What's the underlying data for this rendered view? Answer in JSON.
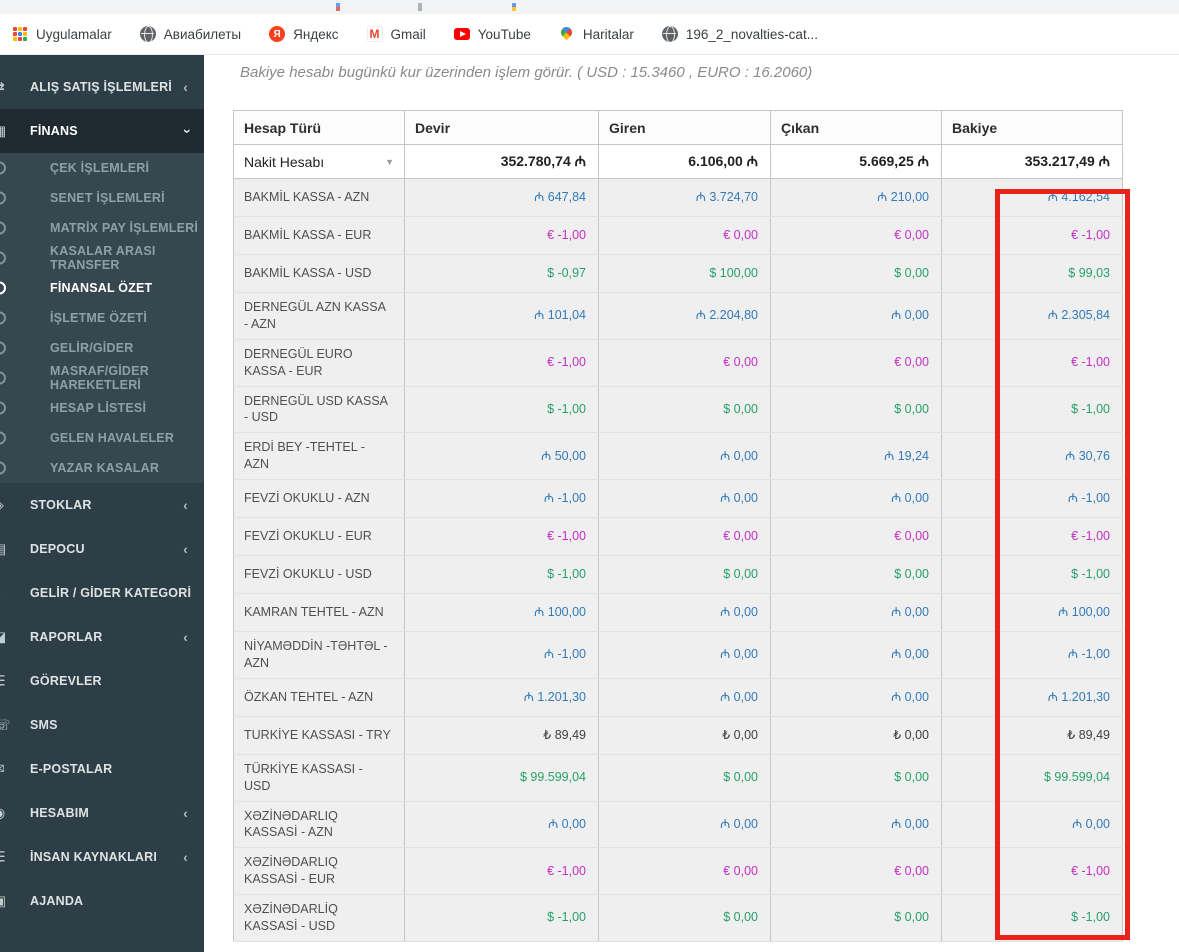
{
  "browser": {
    "bookmarks": [
      {
        "label": "Uygulamalar",
        "icon": "apps-grid-icon"
      },
      {
        "label": "Авиабилеты",
        "icon": "globe-icon"
      },
      {
        "label": "Яндекс",
        "icon": "yandex-icon"
      },
      {
        "label": "Gmail",
        "icon": "gmail-icon"
      },
      {
        "label": "YouTube",
        "icon": "youtube-icon"
      },
      {
        "label": "Haritalar",
        "icon": "maps-icon"
      },
      {
        "label": "196_2_novalties-cat...",
        "icon": "globe-icon"
      }
    ]
  },
  "sidebar": {
    "items": [
      {
        "label": "ALIŞ SATIŞ İŞLEMLERİ",
        "type": "main",
        "chevron": "left",
        "icon": "trade-icon"
      },
      {
        "label": "FİNANS",
        "type": "main",
        "chevron": "down",
        "icon": "finance-icon",
        "open": true
      },
      {
        "label": "ÇEK İŞLEMLERİ",
        "type": "sub",
        "icon": "circle-icon"
      },
      {
        "label": "SENET İŞLEMLERİ",
        "type": "sub",
        "icon": "circle-icon"
      },
      {
        "label": "MATRİX PAY İŞLEMLERİ",
        "type": "sub",
        "icon": "circle-icon"
      },
      {
        "label": "KASALAR ARASI TRANSFER",
        "type": "sub",
        "icon": "circle-icon"
      },
      {
        "label": "FİNANSAL ÖZET",
        "type": "sub",
        "icon": "circle-icon",
        "active": true
      },
      {
        "label": "İŞLETME ÖZETİ",
        "type": "sub",
        "icon": "circle-icon"
      },
      {
        "label": "GELİR/GİDER",
        "type": "sub",
        "icon": "circle-icon"
      },
      {
        "label": "MASRAF/GİDER HAREKETLERİ",
        "type": "sub",
        "icon": "circle-icon"
      },
      {
        "label": "HESAP LİSTESİ",
        "type": "sub",
        "icon": "circle-icon"
      },
      {
        "label": "GELEN HAVALELER",
        "type": "sub",
        "icon": "circle-icon"
      },
      {
        "label": "YAZAR KASALAR",
        "type": "sub",
        "icon": "circle-icon"
      },
      {
        "label": "STOKLAR",
        "type": "main",
        "chevron": "left",
        "icon": "stock-icon"
      },
      {
        "label": "DEPOCU",
        "type": "main",
        "chevron": "left",
        "icon": "warehouse-icon"
      },
      {
        "label": "GELİR / GİDER KATEGORİ",
        "type": "main",
        "icon": "category-icon"
      },
      {
        "label": "RAPORLAR",
        "type": "main",
        "chevron": "left",
        "icon": "reports-icon"
      },
      {
        "label": "GÖREVLER",
        "type": "main",
        "icon": "tasks-icon"
      },
      {
        "label": "SMS",
        "type": "main",
        "icon": "sms-icon"
      },
      {
        "label": "E-POSTALAR",
        "type": "main",
        "icon": "mail-icon"
      },
      {
        "label": "HESABIM",
        "type": "main",
        "chevron": "left",
        "icon": "account-icon"
      },
      {
        "label": "İNSAN KAYNAKLARI",
        "type": "main",
        "chevron": "left",
        "icon": "hr-icon"
      },
      {
        "label": "AJANDA",
        "type": "main",
        "icon": "calendar-icon"
      }
    ]
  },
  "notice": "Bakiye hesabı bugünkü kur üzerinden işlem görür. ( USD : 15.3460 , EURO : 16.2060)",
  "table": {
    "headers": [
      "Hesap Türü",
      "Devir",
      "Giren",
      "Çıkan",
      "Bakiye"
    ],
    "summary_row": {
      "label": "Nakit Hesabı",
      "devir": "352.780,74 ₼",
      "giren": "6.106,00 ₼",
      "cikan": "5.669,25 ₼",
      "bakiye": "353.217,49 ₼"
    },
    "rows": [
      {
        "label": "BAKMİL KASSA - AZN",
        "currency": "AZN",
        "devir": "₼ 647,84",
        "giren": "₼ 3.724,70",
        "cikan": "₼ 210,00",
        "bakiye": "₼ 4.162,54"
      },
      {
        "label": "BAKMİL KASSA - EUR",
        "currency": "EUR",
        "devir": "€ -1,00",
        "giren": "€ 0,00",
        "cikan": "€ 0,00",
        "bakiye": "€ -1,00"
      },
      {
        "label": "BAKMİL KASSA - USD",
        "currency": "USD",
        "devir": "$ -0,97",
        "giren": "$ 100,00",
        "cikan": "$ 0,00",
        "bakiye": "$ 99,03"
      },
      {
        "label": "DERNEGÜL AZN KASSA - AZN",
        "currency": "AZN",
        "devir": "₼ 101,04",
        "giren": "₼ 2.204,80",
        "cikan": "₼ 0,00",
        "bakiye": "₼ 2.305,84"
      },
      {
        "label": "DERNEGÜL EURO KASSA - EUR",
        "currency": "EUR",
        "devir": "€ -1,00",
        "giren": "€ 0,00",
        "cikan": "€ 0,00",
        "bakiye": "€ -1,00"
      },
      {
        "label": "DERNEGÜL USD KASSA - USD",
        "currency": "USD",
        "devir": "$ -1,00",
        "giren": "$ 0,00",
        "cikan": "$ 0,00",
        "bakiye": "$ -1,00"
      },
      {
        "label": "ERDİ BEY -TEHTEL - AZN",
        "currency": "AZN",
        "devir": "₼ 50,00",
        "giren": "₼ 0,00",
        "cikan": "₼ 19,24",
        "bakiye": "₼ 30,76"
      },
      {
        "label": "FEVZİ OKUKLU - AZN",
        "currency": "AZN",
        "devir": "₼ -1,00",
        "giren": "₼ 0,00",
        "cikan": "₼ 0,00",
        "bakiye": "₼ -1,00"
      },
      {
        "label": "FEVZİ OKUKLU - EUR",
        "currency": "EUR",
        "devir": "€ -1,00",
        "giren": "€ 0,00",
        "cikan": "€ 0,00",
        "bakiye": "€ -1,00"
      },
      {
        "label": "FEVZİ OKUKLU - USD",
        "currency": "USD",
        "devir": "$ -1,00",
        "giren": "$ 0,00",
        "cikan": "$ 0,00",
        "bakiye": "$ -1,00"
      },
      {
        "label": "KAMRAN TEHTEL - AZN",
        "currency": "AZN",
        "devir": "₼ 100,00",
        "giren": "₼ 0,00",
        "cikan": "₼ 0,00",
        "bakiye": "₼ 100,00"
      },
      {
        "label": "NİYAMƏDDİN -TƏHTƏL - AZN",
        "currency": "AZN",
        "devir": "₼ -1,00",
        "giren": "₼ 0,00",
        "cikan": "₼ 0,00",
        "bakiye": "₼ -1,00"
      },
      {
        "label": "ÖZKAN TEHTEL - AZN",
        "currency": "AZN",
        "devir": "₼ 1.201,30",
        "giren": "₼ 0,00",
        "cikan": "₼ 0,00",
        "bakiye": "₼ 1.201,30"
      },
      {
        "label": "TURKİYE KASSASI - TRY",
        "currency": "TRY",
        "devir": "₺ 89,49",
        "giren": "₺ 0,00",
        "cikan": "₺ 0,00",
        "bakiye": "₺ 89,49"
      },
      {
        "label": "TÜRKİYE KASSASI - USD",
        "currency": "USD",
        "devir": "$ 99.599,04",
        "giren": "$ 0,00",
        "cikan": "$ 0,00",
        "bakiye": "$ 99.599,04"
      },
      {
        "label": "XƏZİNƏDARLIQ KASSASİ - AZN",
        "currency": "AZN",
        "devir": "₼ 0,00",
        "giren": "₼ 0,00",
        "cikan": "₼ 0,00",
        "bakiye": "₼ 0,00"
      },
      {
        "label": "XƏZİNƏDARLIQ KASSASİ - EUR",
        "currency": "EUR",
        "devir": "€ -1,00",
        "giren": "€ 0,00",
        "cikan": "€ 0,00",
        "bakiye": "€ -1,00"
      },
      {
        "label": "XƏZİNƏDARLİQ KASSASİ - USD",
        "currency": "USD",
        "devir": "$ -1,00",
        "giren": "$ 0,00",
        "cikan": "$ 0,00",
        "bakiye": "$ -1,00"
      }
    ]
  },
  "colors": {
    "azn_text": "#337ab7",
    "eur_text": "#c42ec4",
    "usd_text": "#27a06b",
    "try_text": "#404040",
    "highlight_box": "#e9221b",
    "sidebar_bg": "#2e3e46",
    "sidebar_submenu_bg": "#37474f",
    "sidebar_active_bg": "#1f2a30"
  }
}
